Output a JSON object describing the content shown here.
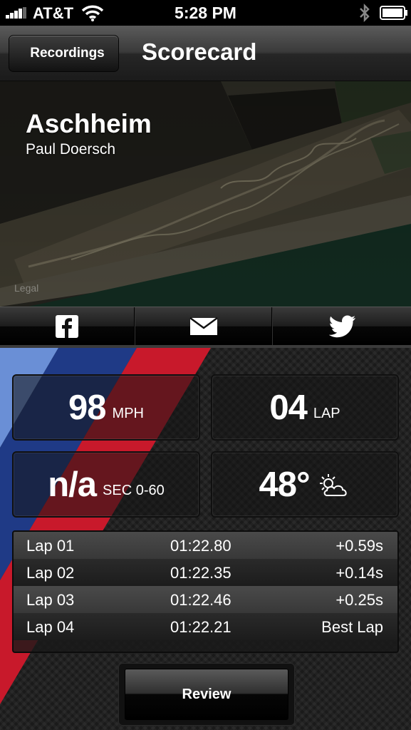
{
  "status_bar": {
    "carrier": "AT&T",
    "time": "5:28 PM"
  },
  "nav": {
    "back_label": "Recordings",
    "title": "Scorecard"
  },
  "map": {
    "track_name": "Aschheim",
    "driver_name": "Paul Doersch",
    "legal_label": "Legal"
  },
  "share": {
    "facebook": "facebook-icon",
    "email": "envelope-icon",
    "twitter": "twitter-bird-icon"
  },
  "stats": {
    "speed_value": "98",
    "speed_unit": "MPH",
    "lap_value": "04",
    "lap_unit": "LAP",
    "accel_value": "n/a",
    "accel_unit": "SEC 0-60",
    "temp_value": "48°",
    "weather_icon": "partly-sunny-icon"
  },
  "laps": [
    {
      "lap": "Lap 01",
      "time": "01:22.80",
      "delta": "+0.59s"
    },
    {
      "lap": "Lap 02",
      "time": "01:22.35",
      "delta": "+0.14s"
    },
    {
      "lap": "Lap 03",
      "time": "01:22.46",
      "delta": "+0.25s"
    },
    {
      "lap": "Lap 04",
      "time": "01:22.21",
      "delta": "Best Lap"
    }
  ],
  "review_label": "Review",
  "colors": {
    "stripe_light_blue": "#6a8fd6",
    "stripe_dark_blue": "#1f3a86",
    "stripe_red": "#c8192b"
  }
}
